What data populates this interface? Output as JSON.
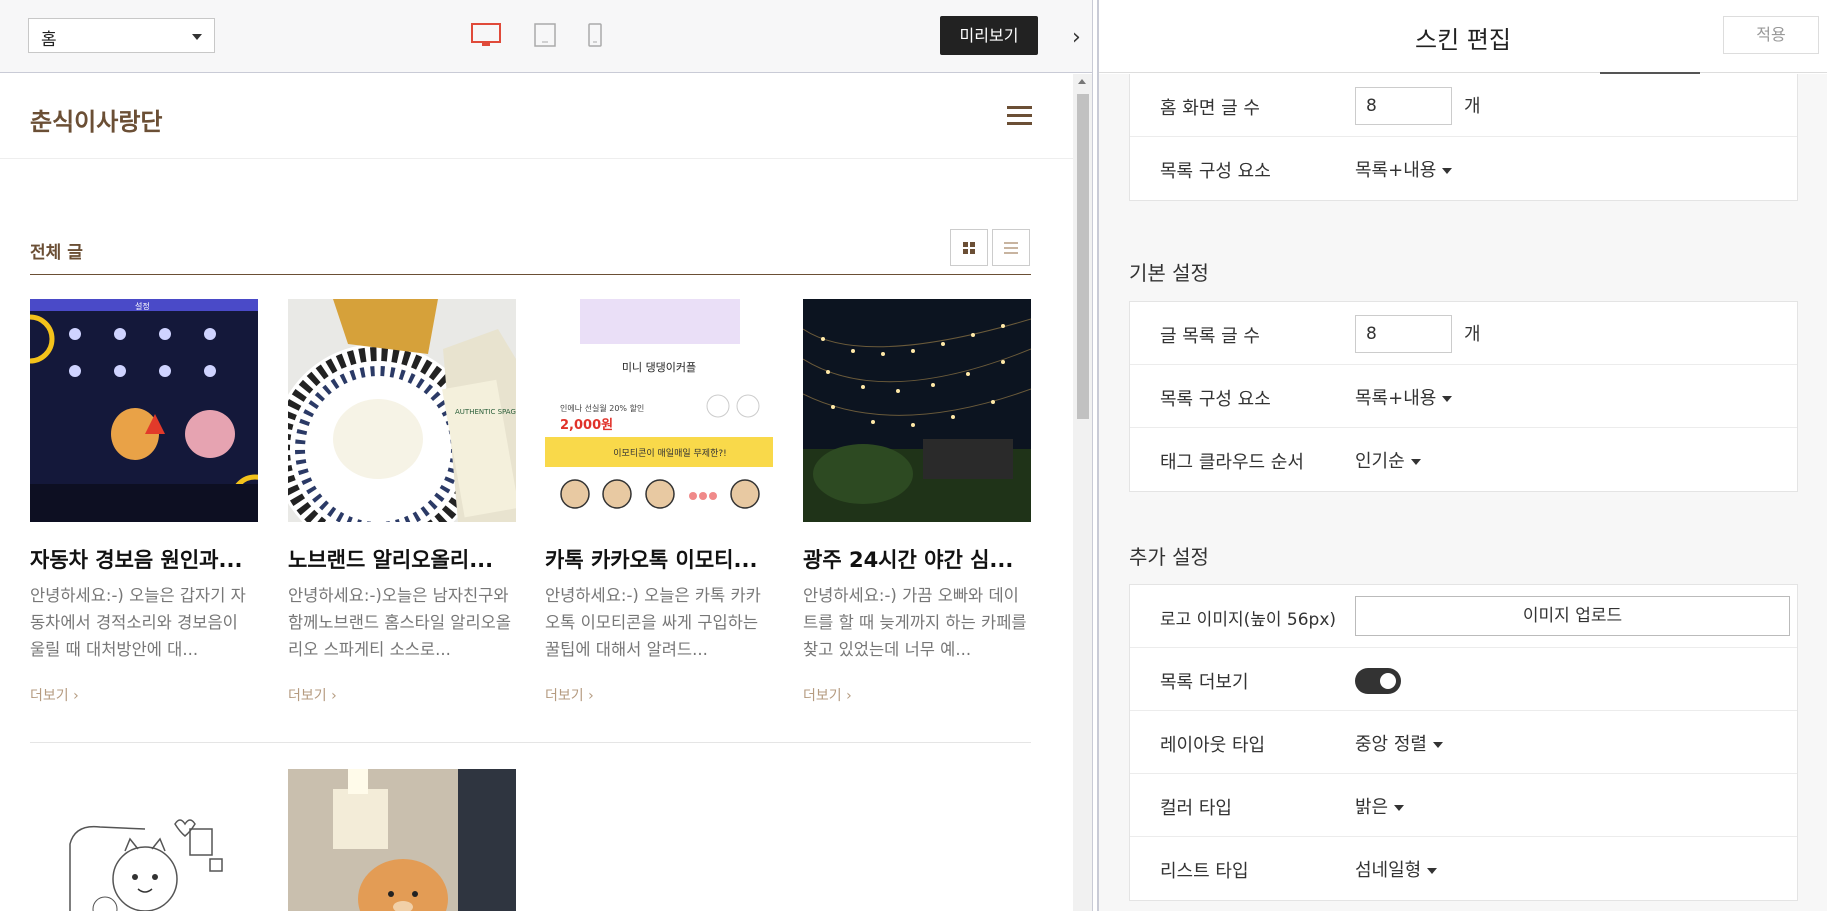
{
  "toolbar": {
    "page_select": "홈",
    "preview_label": "미리보기"
  },
  "blog": {
    "title": "춘식이사랑단",
    "section_title": "전체 글",
    "more_label": "더보기",
    "posts": [
      {
        "title": "자동차 경보음 원인과...",
        "excerpt": "안녕하세요:-) 오늘은 갑자기 자동차에서 경적소리와 경보음이 울릴 때 대처방안에 대..."
      },
      {
        "title": "노브랜드 알리오올리...",
        "excerpt": "안녕하세요:-)오늘은 남자친구와 함께노브랜드 홈스타일 알리오올리오 스파게티 소스로..."
      },
      {
        "title": "카톡 카카오톡 이모티...",
        "excerpt": "안녕하세요:-) 오늘은 카톡 카카오톡 이모티콘을 싸게 구입하는 꿀팁에 대해서 알려드..."
      },
      {
        "title": "광주 24시간 야간 심...",
        "excerpt": "안녕하세요:-) 가끔 오빠와 데이트를 할 때 늦게까지 하는 카페를 찾고 있었는데 너무 예..."
      }
    ],
    "thumb_texts": {
      "emoticon_name": "미니 댕댕이커플",
      "emoticon_price": "2,000원",
      "emoticon_discount": "인에나 선실월 20% 할인",
      "emoticon_banner": "이모티콘이 매일매일 무제한?!",
      "pasta_brand": "AUTHENTIC SPAGHETTI",
      "car_tab": "설정"
    }
  },
  "panel": {
    "title": "스킨 편집",
    "apply_label": "적용",
    "home_group": {
      "rows": [
        {
          "label": "홈 화면 글 수",
          "value": "8",
          "unit": "개"
        },
        {
          "label": "목록 구성 요소",
          "value": "목록+내용"
        }
      ]
    },
    "basic_group": {
      "title": "기본 설정",
      "rows": [
        {
          "label": "글 목록 글 수",
          "value": "8",
          "unit": "개"
        },
        {
          "label": "목록 구성 요소",
          "value": "목록+내용"
        },
        {
          "label": "태그 클라우드 순서",
          "value": "인기순"
        }
      ]
    },
    "extra_group": {
      "title": "추가 설정",
      "rows": [
        {
          "label": "로고 이미지(높이 56px)",
          "value": "이미지 업로드"
        },
        {
          "label": "목록 더보기",
          "value": "on"
        },
        {
          "label": "레이아웃 타입",
          "value": "중앙 정렬"
        },
        {
          "label": "컬러 타입",
          "value": "밝은"
        },
        {
          "label": "리스트 타입",
          "value": "섬네일형"
        }
      ]
    }
  },
  "colors": {
    "accent": "#6b4f35",
    "dark": "#222222",
    "device_active": "#e04a3a"
  }
}
